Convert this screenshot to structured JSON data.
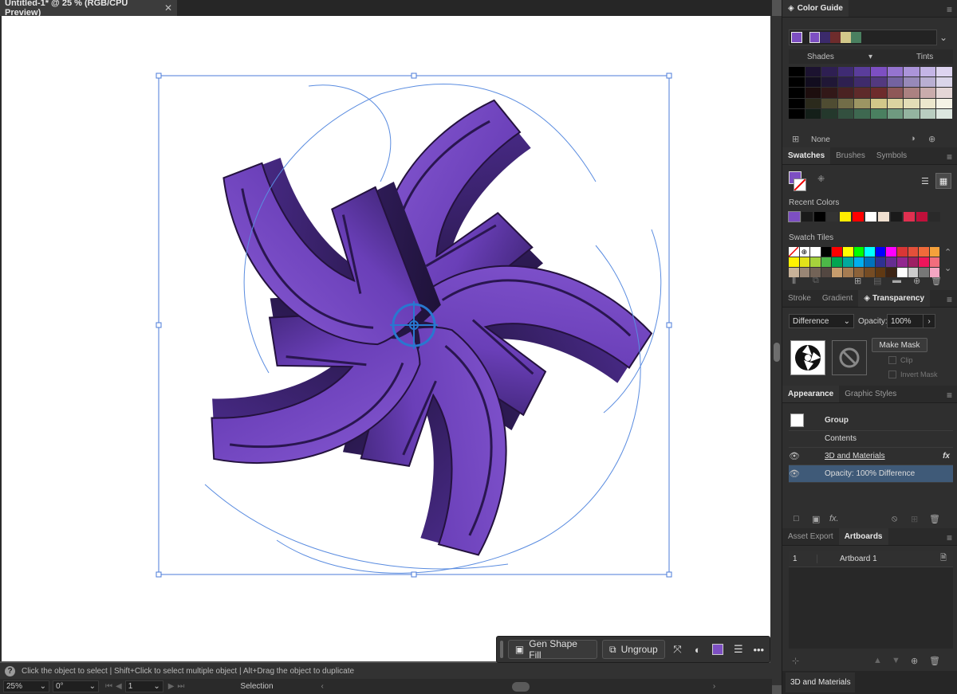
{
  "document": {
    "tab_title": "Untitled-1* @ 25 % (RGB/CPU Preview)",
    "close_glyph": "✕"
  },
  "task_bar": {
    "gen_shape_fill_label": "Gen Shape Fill",
    "ungroup_label": "Ungroup",
    "fill_color": "#7d4fc2"
  },
  "status": {
    "hint": "Click the object to select  |  Shift+Click to select multiple object  |  Alt+Drag the object to duplicate",
    "zoom": "25%",
    "rotation": "0°",
    "artboard_number": "1",
    "tool": "Selection"
  },
  "color_guide": {
    "title": "Color Guide",
    "base_color": "#7d4fc2",
    "harmony": [
      "#7d4fc2",
      "#3b2a6b",
      "#6e2c2c",
      "#d2c88a",
      "#4a8060"
    ],
    "shades_label": "Shades",
    "tints_label": "Tints",
    "none_label": "None",
    "grid_rows": [
      [
        "#000000",
        "#1c1330",
        "#2e1f52",
        "#3f2b73",
        "#5a3d9b",
        "#7d4fc2",
        "#9574cf",
        "#ab94da",
        "#c4b5e6",
        "#ddd4f0"
      ],
      [
        "#000000",
        "#120d1f",
        "#201736",
        "#2e2050",
        "#3f2b6b",
        "#53397f",
        "#7463a0",
        "#9789b9",
        "#b9afd2",
        "#dad5e9"
      ],
      [
        "#000000",
        "#1d0e0e",
        "#321818",
        "#4a2222",
        "#5e2a2a",
        "#6e2c2c",
        "#8e5757",
        "#ab8181",
        "#c9acac",
        "#e4d6d6"
      ],
      [
        "#000000",
        "#2b2a1c",
        "#4f4c32",
        "#726d48",
        "#9c9563",
        "#d2c88a",
        "#dbd3a0",
        "#e3ddb7",
        "#ece7cd",
        "#f5f3e6"
      ],
      [
        "#000000",
        "#141f19",
        "#24382c",
        "#33503f",
        "#3e6850",
        "#4a8060",
        "#6f9a80",
        "#94b4a0",
        "#b9cdc0",
        "#dce6df"
      ]
    ]
  },
  "swatches_panel": {
    "tabs": [
      "Swatches",
      "Brushes",
      "Symbols"
    ],
    "recent_colors_label": "Recent Colors",
    "recent_colors": [
      "#7d4fc2",
      "#1a1a1a",
      "#000000",
      "#333333",
      "#ffec00",
      "#ff0000",
      "#ffffff",
      "#f0e0d0",
      "#1a1a1a",
      "#e03050",
      "#c0103a",
      "#2a2a2a"
    ],
    "swatch_tiles_label": "Swatch Tiles",
    "tiles_rows": [
      [
        "none",
        "reg",
        "#ffffff",
        "#000000",
        "#ff0000",
        "#ffff00",
        "#00ff00",
        "#00ffff",
        "#0000ff",
        "#ff00ff",
        "#d93636",
        "#e4503a",
        "#ef6a3a",
        "#f5a13b"
      ],
      [
        "#fff200",
        "#e3e31a",
        "#a6d23c",
        "#4db848",
        "#00a651",
        "#00a99d",
        "#00aeef",
        "#0072bc",
        "#2e3192",
        "#662d91",
        "#92278f",
        "#9e1f63",
        "#ed145b",
        "#f26d7d"
      ],
      [
        "#c7b299",
        "#998675",
        "#736357",
        "#534741",
        "#c69c6d",
        "#a67c52",
        "#8c6239",
        "#754c24",
        "#603913",
        "#3c2415",
        "#ffffff",
        "#cccccc",
        "#777777",
        "#f4a6c3"
      ]
    ]
  },
  "transparency_panel": {
    "tabs": [
      "Stroke",
      "Gradient",
      "Transparency"
    ],
    "blend_mode": "Difference",
    "opacity_label": "Opacity:",
    "opacity_value": "100%",
    "make_mask_label": "Make Mask",
    "clip_label": "Clip",
    "invert_mask_label": "Invert Mask"
  },
  "appearance_panel": {
    "tabs": [
      "Appearance",
      "Graphic Styles"
    ],
    "object_type": "Group",
    "contents_label": "Contents",
    "effect_label": "3D and Materials",
    "fx_label": "fx",
    "opacity_row": "Opacity:  100% Difference"
  },
  "artboards_panel": {
    "tabs": [
      "Asset Export",
      "Artboards"
    ],
    "rows": [
      {
        "index": "1",
        "name": "Artboard 1"
      }
    ]
  },
  "collapsed_panel": {
    "label": "3D and Materials"
  }
}
